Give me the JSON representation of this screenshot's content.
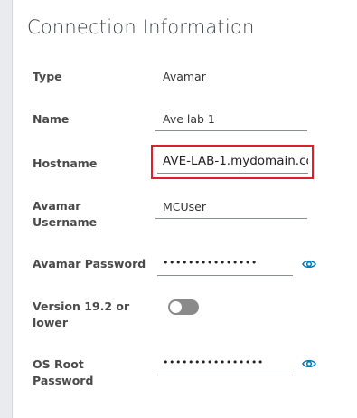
{
  "title": "Connection Information",
  "fields": {
    "type": {
      "label": "Type",
      "value": "Avamar"
    },
    "name": {
      "label": "Name",
      "value": "Ave lab 1"
    },
    "hostname": {
      "label": "Hostname",
      "value": "AVE-LAB-1.mydomain.co"
    },
    "username": {
      "label_line1": "Avamar",
      "label_line2": "Username",
      "value": "MCUser"
    },
    "password": {
      "label": "Avamar Password",
      "masked": "•••••••••••••••"
    },
    "version": {
      "label_line1": "Version 19.2 or",
      "label_line2": "lower",
      "toggle_on": false
    },
    "os_root_password": {
      "label_line1": "OS Root",
      "label_line2": "Password",
      "masked": "••••••••••••••••"
    }
  },
  "icons": {
    "reveal": "eye-icon"
  },
  "colors": {
    "accent": "#0079b8",
    "highlight": "#e01e2e",
    "toggle_off": "#8a8a8a"
  }
}
